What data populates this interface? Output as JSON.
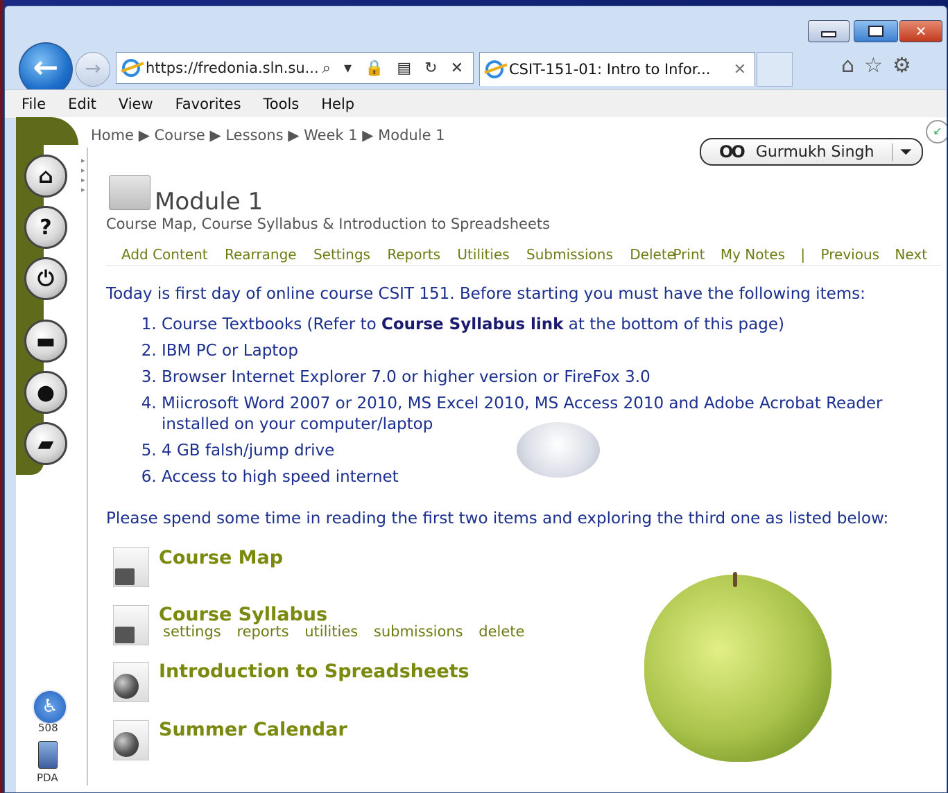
{
  "browser": {
    "address_url": "https://fredonia.sln.su...",
    "address_tools": "⌕ ▾ 🔒 ▤ ↻ ✕",
    "tab_title": "CSIT-151-01: Intro to Infor...",
    "tab_close": "✕",
    "close_glyph": "✕",
    "back_glyph": "←",
    "fwd_glyph": "→",
    "top_icons": "⌂☆⚙"
  },
  "menu": [
    "File",
    "Edit",
    "View",
    "Favorites",
    "Tools",
    "Help"
  ],
  "breadcrumb": "Home ▶ Course ▶ Lessons ▶ Week 1 ▶ Module 1",
  "user": {
    "glasses": "OO",
    "name": "Gurmukh Singh",
    "dropdown": "⏷"
  },
  "corner_glyph": "↙",
  "sidebar": {
    "buttons": [
      "⌂",
      "?",
      "⏻",
      "▬",
      "●",
      "▰"
    ],
    "a508_glyph": "♿",
    "a508_label": "508",
    "pda_label": "PDA"
  },
  "module": {
    "title": "Module 1",
    "subtitle": "Course Map, Course Syllabus & Introduction to Spreadsheets"
  },
  "actions_left": [
    "Add Content",
    "Rearrange",
    "Settings",
    "Reports",
    "Utilities",
    "Submissions",
    "Delete"
  ],
  "actions_right": [
    "Print",
    "My Notes",
    "|",
    "Previous",
    "Next"
  ],
  "intro": "Today is first day of online course CSIT 151. Before starting you must  have the following items:",
  "list": {
    "i1_pre": "Course Textbooks (Refer to ",
    "i1_bold": "Course Syllabus link",
    "i1_post": " at the bottom of this page)",
    "i2": "IBM PC or Laptop",
    "i3": "Browser Internet Explorer 7.0 or higher version or FireFox 3.0",
    "i4": "Miicrosoft Word 2007 or 2010, MS Excel 2010, MS Access 2010 and Adobe Acrobat Reader installed on your computer/laptop",
    "i5": "4 GB falsh/jump drive",
    "i6": "Access to high speed internet"
  },
  "note": "Please spend some time in reading the first two items and exploring the third one as listed below:",
  "items": {
    "course_map": "Course Map",
    "course_syllabus": "Course Syllabus",
    "syllabus_links": [
      "settings",
      "reports",
      "utilities",
      "submissions",
      "delete"
    ],
    "intro_spreadsheets": "Introduction to Spreadsheets",
    "summer_calendar": "Summer Calendar"
  }
}
